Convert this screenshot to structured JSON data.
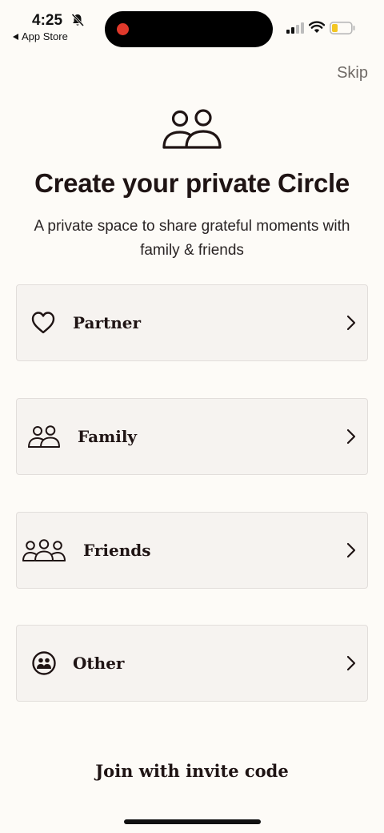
{
  "status_bar": {
    "time": "4:25",
    "back_app": "App Store"
  },
  "header": {
    "skip_label": "Skip"
  },
  "main": {
    "title": "Create your private Circle",
    "subtitle": "A private space to share grateful moments with family & friends",
    "options": [
      {
        "label": "Partner",
        "icon": "heart-icon"
      },
      {
        "label": "Family",
        "icon": "two-people-icon"
      },
      {
        "label": "Friends",
        "icon": "three-people-icon"
      },
      {
        "label": "Other",
        "icon": "group-circle-icon"
      }
    ],
    "join_label": "Join with invite code"
  },
  "colors": {
    "background": "#fdfbf7",
    "card": "#f6f3f0",
    "text": "#1f1414",
    "record_dot": "#e0392b",
    "battery_fill": "#f3c623"
  }
}
